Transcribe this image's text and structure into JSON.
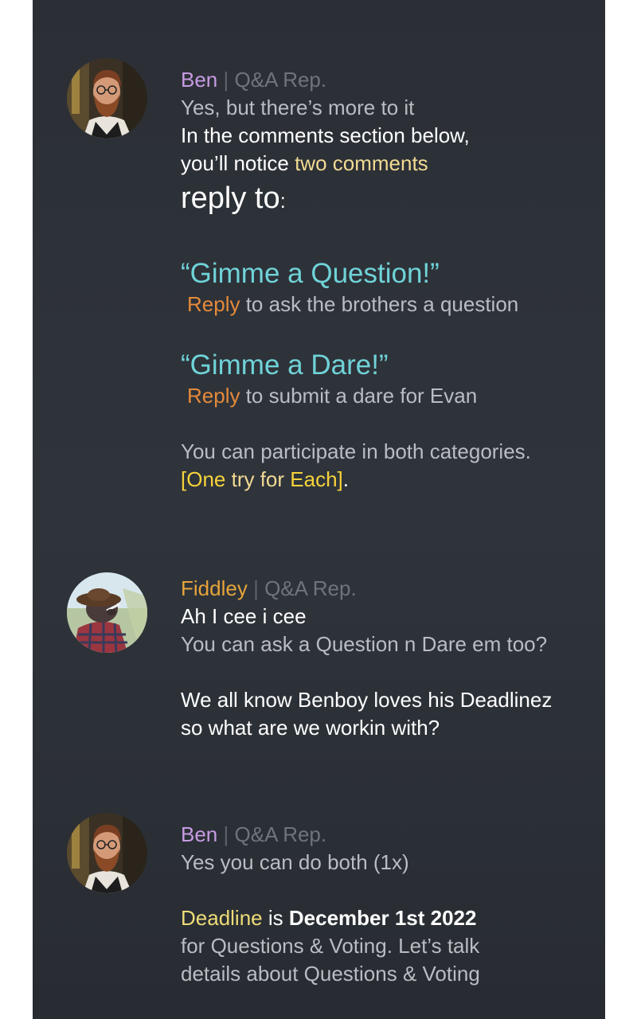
{
  "messages": [
    {
      "author": "Ben",
      "separator": "|",
      "role": "Q&A Rep.",
      "lines": {
        "l1": "Yes, but there’s more to it",
        "l2": "In the comments section below,",
        "l3a": "you’ll notice ",
        "l3b": "two comments",
        "l4a": "reply to",
        "l4b": ":",
        "q1_title": "“Gimme a Question!”",
        "q1_reply": "Reply",
        "q1_rest": " to ask the brothers a question",
        "q2_title": "“Gimme a Dare!”",
        "q2_reply": "Reply",
        "q2_rest": " to submit a dare for Evan",
        "l5": "You can participate in both categories.",
        "l6a": "[One",
        "l6b": " try for ",
        "l6c": "Each]",
        "l6d": "."
      }
    },
    {
      "author": "Fiddley",
      "separator": "|",
      "role": "Q&A Rep.",
      "lines": {
        "l1": "Ah I cee i cee",
        "l2": "You can ask a Question n Dare em too?",
        "l3": "We all know Benboy loves his Deadlinez",
        "l4": "so what are we workin with?"
      }
    },
    {
      "author": "Ben",
      "separator": "|",
      "role": "Q&A Rep.",
      "lines": {
        "l1": "Yes you can do both (1x)",
        "l2a": "Deadline",
        "l2b": " is ",
        "l2c": "December 1st 2022",
        "l3": "for Questions & Voting. Let’s talk",
        "l4": "details about Questions & Voting"
      }
    }
  ],
  "colors": {
    "background": "#2d3138",
    "ben_name": "#c79be3",
    "fiddley_name": "#e6a43a",
    "role": "#6f747b",
    "highlight_cyan": "#6fd3d8",
    "highlight_orange": "#e58a3a",
    "highlight_yellow": "#f7d33a",
    "highlight_gold": "#f1da93"
  },
  "icons": {
    "ben_avatar": "bearded-man-portrait",
    "fiddley_avatar": "character-with-hat-portrait"
  }
}
